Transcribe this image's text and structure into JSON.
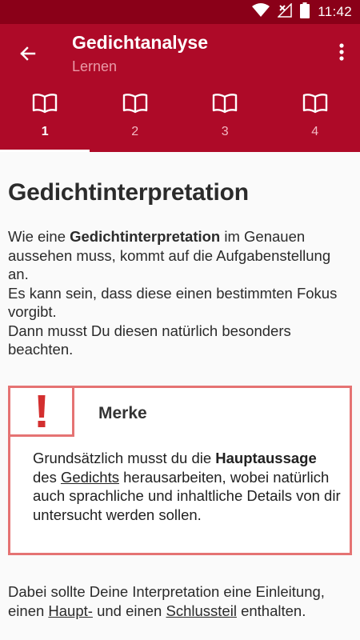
{
  "status_bar": {
    "time": "11:42",
    "icons": [
      "wifi-icon",
      "no-signal-icon",
      "battery-icon"
    ]
  },
  "app_bar": {
    "title": "Gedichtanalyse",
    "subtitle": "Lernen",
    "color": "#ae0a28"
  },
  "tabs": [
    {
      "label": "1",
      "icon": "book-icon",
      "active": true
    },
    {
      "label": "2",
      "icon": "book-icon",
      "active": false
    },
    {
      "label": "3",
      "icon": "book-icon",
      "active": false
    },
    {
      "label": "4",
      "icon": "book-icon",
      "active": false
    }
  ],
  "content": {
    "heading": "Gedichtinterpretation",
    "intro": {
      "pre": "Wie eine ",
      "bold": "Gedichtinterpretation",
      "post": " im Genauen aussehen muss, kommt auf die Aufgabenstellung an.",
      "line2": "Es kann sein, dass diese einen bestimmten Fokus vorgibt.",
      "line3": "Dann musst Du diesen natürlich besonders beachten."
    },
    "merke": {
      "icon": "exclamation-icon",
      "title": "Merke",
      "pre": "Grundsätzlich musst du die ",
      "bold": "Hauptaussage",
      "mid": " des ",
      "link": "Gedichts",
      "post": " herausarbeiten, wobei natürlich auch sprachliche und inhaltliche Details von dir untersucht werden sollen.",
      "border_color": "#e57373"
    },
    "outro": {
      "pre": "Dabei sollte Deine Interpretation eine Einleitung, einen ",
      "link1": "Haupt-",
      "mid": " und einen ",
      "link2": "Schlussteil",
      "post": " enthalten."
    }
  }
}
